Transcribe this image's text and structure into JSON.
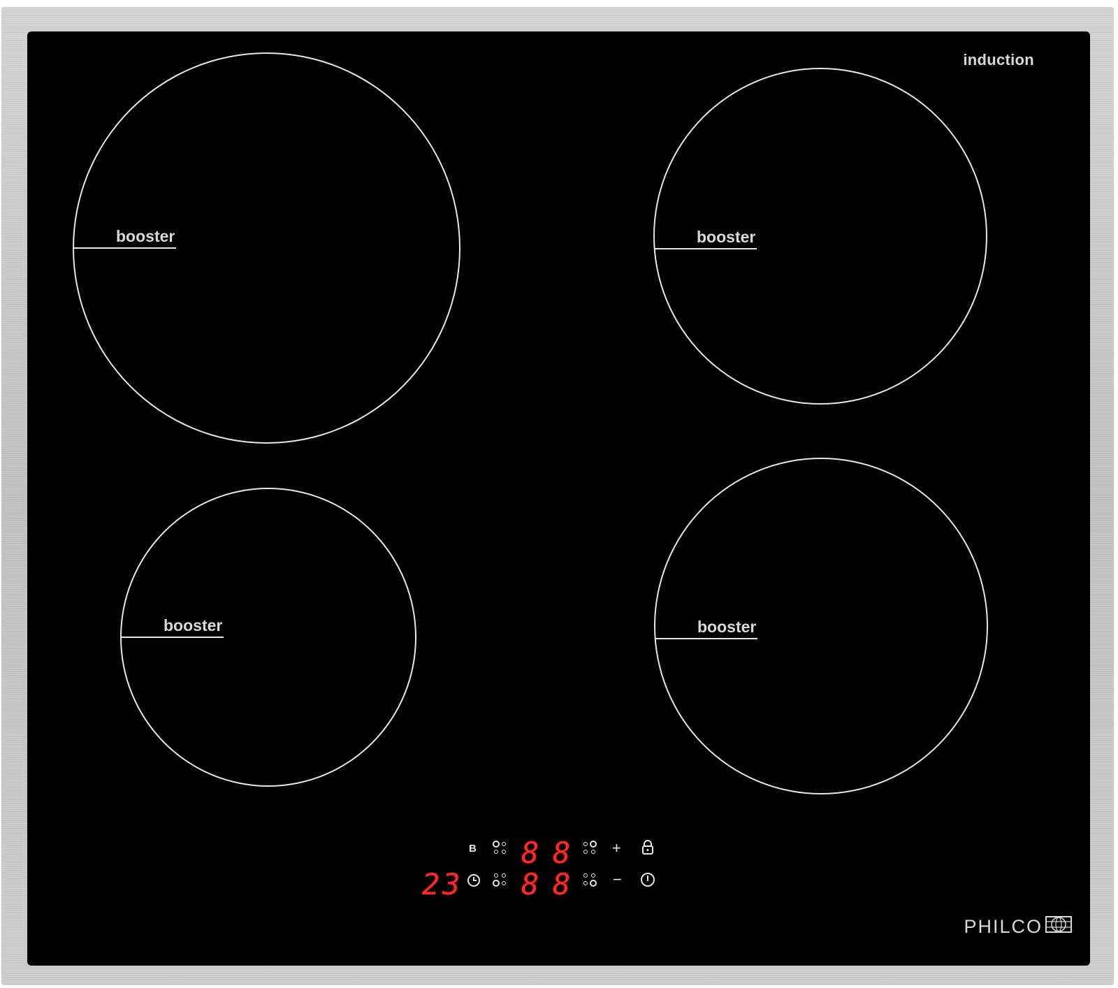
{
  "hob": {
    "type_label": "induction",
    "zones": [
      {
        "label": "booster"
      },
      {
        "label": "booster"
      },
      {
        "label": "booster"
      },
      {
        "label": "booster"
      }
    ],
    "control_panel": {
      "booster_key": "B",
      "timer_display": "23",
      "zone_displays_top": [
        "8",
        "8"
      ],
      "zone_displays_bottom": [
        "8",
        "8"
      ],
      "plus_key": "+",
      "minus_key": "−"
    },
    "brand": "PHILCO"
  },
  "colors": {
    "glass": "#000000",
    "frame": "#c8c8c8",
    "print": "#e6e6e6",
    "led": "#ff2a2a"
  }
}
